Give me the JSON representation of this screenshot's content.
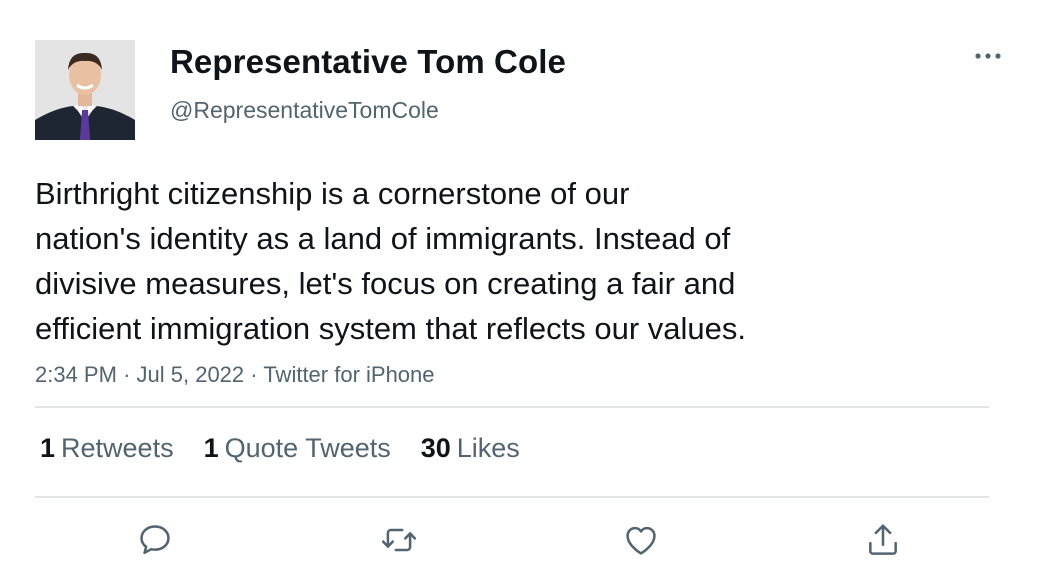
{
  "author": {
    "display_name": "Representative Tom Cole",
    "handle": "@RepresentativeTomCole"
  },
  "tweet": {
    "text": "Birthright citizenship is a cornerstone of our\nnation's identity as a land of immigrants. Instead of\ndivisive measures, let's focus on creating a fair and\nefficient immigration system that reflects our values.",
    "time": "2:34 PM",
    "date": "Jul 5, 2022",
    "source": "Twitter for iPhone",
    "separator": "·"
  },
  "stats": [
    {
      "count": "1",
      "label": "Retweets"
    },
    {
      "count": "1",
      "label": "Quote Tweets"
    },
    {
      "count": "30",
      "label": "Likes"
    }
  ],
  "icons": {
    "more": "more-horizontal-icon",
    "reply": "reply-bubble-icon",
    "retweet": "retweet-icon",
    "like": "heart-icon",
    "share": "share-upload-icon"
  },
  "colors": {
    "text": "#0f1419",
    "secondary": "#536471",
    "divider": "#e1e5e8",
    "action_icon": "#536471"
  }
}
